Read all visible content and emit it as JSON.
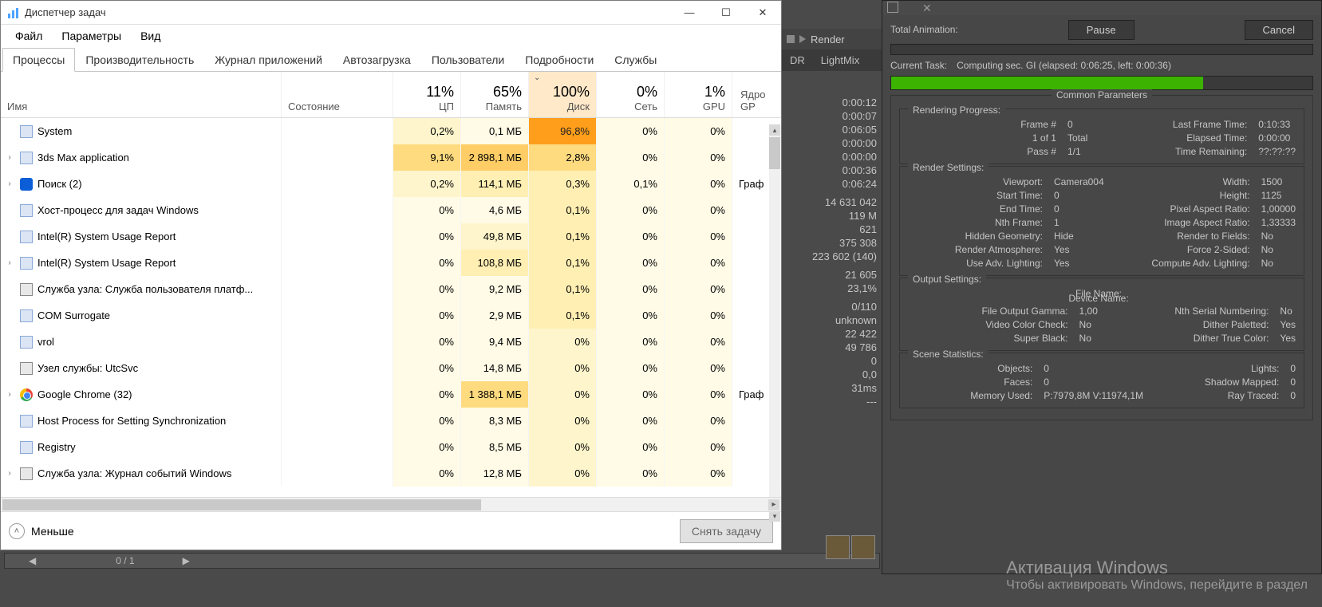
{
  "task_manager": {
    "title": "Диспетчер задач",
    "winbuttons": {
      "min": "—",
      "max": "☐",
      "close": "✕"
    },
    "menu": [
      "Файл",
      "Параметры",
      "Вид"
    ],
    "tabs": [
      "Процессы",
      "Производительность",
      "Журнал приложений",
      "Автозагрузка",
      "Пользователи",
      "Подробности",
      "Службы"
    ],
    "selected_tab": 0,
    "columns": {
      "name": "Имя",
      "state": "Состояние",
      "metrics": [
        {
          "percent": "11%",
          "label": "ЦП"
        },
        {
          "percent": "65%",
          "label": "Память"
        },
        {
          "percent": "100%",
          "label": "Диск",
          "sorted": true
        },
        {
          "percent": "0%",
          "label": "Сеть"
        },
        {
          "percent": "1%",
          "label": "GPU"
        }
      ],
      "engine": "Ядро GP"
    },
    "rows": [
      {
        "expand": false,
        "icon": "app",
        "name": "System",
        "cpu": "0,2%",
        "mem": "0,1 МБ",
        "disk": "96,8%",
        "net": "0%",
        "gpu": "0%",
        "engine": "",
        "heat": [
          2,
          1,
          8,
          1,
          1
        ]
      },
      {
        "expand": true,
        "icon": "app",
        "name": "3ds Max application",
        "cpu": "9,1%",
        "mem": "2 898,1 МБ",
        "disk": "2,8%",
        "net": "0%",
        "gpu": "0%",
        "engine": "",
        "heat": [
          5,
          6,
          5,
          1,
          1
        ]
      },
      {
        "expand": true,
        "icon": "search",
        "name": "Поиск (2)",
        "cpu": "0,2%",
        "mem": "114,1 МБ",
        "disk": "0,3%",
        "net": "0,1%",
        "gpu": "0%",
        "engine": "Граф",
        "heat": [
          2,
          3,
          3,
          1,
          1
        ]
      },
      {
        "expand": false,
        "icon": "app",
        "name": "Хост-процесс для задач Windows",
        "cpu": "0%",
        "mem": "4,6 МБ",
        "disk": "0,1%",
        "net": "0%",
        "gpu": "0%",
        "engine": "",
        "heat": [
          1,
          1,
          3,
          1,
          1
        ]
      },
      {
        "expand": false,
        "icon": "app",
        "name": "Intel(R) System Usage Report",
        "cpu": "0%",
        "mem": "49,8 МБ",
        "disk": "0,1%",
        "net": "0%",
        "gpu": "0%",
        "engine": "",
        "heat": [
          1,
          2,
          3,
          1,
          1
        ]
      },
      {
        "expand": true,
        "icon": "app",
        "name": "Intel(R) System Usage Report",
        "cpu": "0%",
        "mem": "108,8 МБ",
        "disk": "0,1%",
        "net": "0%",
        "gpu": "0%",
        "engine": "",
        "heat": [
          1,
          3,
          3,
          1,
          1
        ]
      },
      {
        "expand": false,
        "icon": "gear",
        "name": "Служба узла: Служба пользователя платф...",
        "cpu": "0%",
        "mem": "9,2 МБ",
        "disk": "0,1%",
        "net": "0%",
        "gpu": "0%",
        "engine": "",
        "heat": [
          1,
          1,
          3,
          1,
          1
        ]
      },
      {
        "expand": false,
        "icon": "app",
        "name": "COM Surrogate",
        "cpu": "0%",
        "mem": "2,9 МБ",
        "disk": "0,1%",
        "net": "0%",
        "gpu": "0%",
        "engine": "",
        "heat": [
          1,
          1,
          3,
          1,
          1
        ]
      },
      {
        "expand": false,
        "icon": "vrol",
        "name": "vrol",
        "cpu": "0%",
        "mem": "9,4 МБ",
        "disk": "0%",
        "net": "0%",
        "gpu": "0%",
        "engine": "",
        "heat": [
          1,
          1,
          2,
          1,
          1
        ]
      },
      {
        "expand": false,
        "icon": "gear",
        "name": "Узел службы: UtcSvc",
        "cpu": "0%",
        "mem": "14,8 МБ",
        "disk": "0%",
        "net": "0%",
        "gpu": "0%",
        "engine": "",
        "heat": [
          1,
          1,
          2,
          1,
          1
        ]
      },
      {
        "expand": true,
        "icon": "chrome",
        "name": "Google Chrome (32)",
        "cpu": "0%",
        "mem": "1 388,1 МБ",
        "disk": "0%",
        "net": "0%",
        "gpu": "0%",
        "engine": "Граф",
        "heat": [
          1,
          5,
          2,
          1,
          1
        ]
      },
      {
        "expand": false,
        "icon": "app",
        "name": "Host Process for Setting Synchronization",
        "cpu": "0%",
        "mem": "8,3 МБ",
        "disk": "0%",
        "net": "0%",
        "gpu": "0%",
        "engine": "",
        "heat": [
          1,
          1,
          2,
          1,
          1
        ]
      },
      {
        "expand": false,
        "icon": "app",
        "name": "Registry",
        "cpu": "0%",
        "mem": "8,5 МБ",
        "disk": "0%",
        "net": "0%",
        "gpu": "0%",
        "engine": "",
        "heat": [
          1,
          1,
          2,
          1,
          1
        ]
      },
      {
        "expand": true,
        "icon": "gear",
        "name": "Служба узла: Журнал событий Windows",
        "cpu": "0%",
        "mem": "12,8 МБ",
        "disk": "0%",
        "net": "0%",
        "gpu": "0%",
        "engine": "",
        "heat": [
          1,
          1,
          2,
          1,
          1
        ]
      }
    ],
    "footer": {
      "fewer": "Меньше",
      "end_task": "Снять задачу"
    }
  },
  "bg_ui": {
    "tabs": [
      "DR",
      "LightMix"
    ],
    "render_btn": "Render",
    "stats_blocks": [
      [
        "0:00:12",
        "0:00:07",
        "0:06:05",
        "0:00:00",
        "0:00:00",
        "0:00:36",
        "0:06:24"
      ],
      [
        "14 631 042",
        "119 M",
        "621",
        "375 308",
        "223 602 (140)"
      ],
      [
        "21 605",
        "23,1%"
      ],
      [
        "0/110",
        "unknown",
        "22 422",
        "49 786",
        "0",
        "0,0",
        "31ms",
        "---"
      ]
    ],
    "timeline_frame": "0 / 1"
  },
  "render_dialog": {
    "total_anim_label": "Total Animation:",
    "pause": "Pause",
    "cancel": "Cancel",
    "current_task_label": "Current Task:",
    "current_task_value": "Computing sec. GI (elapsed: 0:06:25, left: 0:00:36)",
    "common_params": "Common Parameters",
    "rendering_progress": "Rendering Progress:",
    "frame_num_label": "Frame #",
    "frame_num": "0",
    "last_frame_time_label": "Last Frame Time:",
    "last_frame_time": "0:10:33",
    "of_label": "1  of  1",
    "total_label": "Total",
    "elapsed_label": "Elapsed Time:",
    "elapsed": "0:00:00",
    "pass_label": "Pass #",
    "pass": "1/1",
    "time_rem_label": "Time Remaining:",
    "time_rem": "??:??:??",
    "render_settings": "Render Settings:",
    "rs": {
      "viewport_k": "Viewport:",
      "viewport_v": "Camera004",
      "width_k": "Width:",
      "width_v": "1500",
      "start_k": "Start Time:",
      "start_v": "0",
      "height_k": "Height:",
      "height_v": "1125",
      "end_k": "End Time:",
      "end_v": "0",
      "par_k": "Pixel Aspect Ratio:",
      "par_v": "1,00000",
      "nth_k": "Nth Frame:",
      "nth_v": "1",
      "iar_k": "Image Aspect Ratio:",
      "iar_v": "1,33333",
      "hg_k": "Hidden Geometry:",
      "hg_v": "Hide",
      "rtf_k": "Render to Fields:",
      "rtf_v": "No",
      "ra_k": "Render Atmosphere:",
      "ra_v": "Yes",
      "f2s_k": "Force 2-Sided:",
      "f2s_v": "No",
      "ual_k": "Use Adv. Lighting:",
      "ual_v": "Yes",
      "cal_k": "Compute Adv. Lighting:",
      "cal_v": "No"
    },
    "output_settings": "Output Settings:",
    "os": {
      "file_k": "File Name:",
      "file_v": "",
      "dev_k": "Device Name:",
      "dev_v": "",
      "fog_k": "File Output Gamma:",
      "fog_v": "1,00",
      "nsn_k": "Nth Serial Numbering:",
      "nsn_v": "No",
      "vcc_k": "Video Color Check:",
      "vcc_v": "No",
      "dp_k": "Dither Paletted:",
      "dp_v": "Yes",
      "sb_k": "Super Black:",
      "sb_v": "No",
      "dtc_k": "Dither True Color:",
      "dtc_v": "Yes"
    },
    "scene_stats": "Scene Statistics:",
    "ss": {
      "obj_k": "Objects:",
      "obj_v": "0",
      "lights_k": "Lights:",
      "lights_v": "0",
      "faces_k": "Faces:",
      "faces_v": "0",
      "sm_k": "Shadow Mapped:",
      "sm_v": "0",
      "mem_k": "Memory Used:",
      "mem_v": "P:7979,8M V:11974,1M",
      "rt_k": "Ray Traced:",
      "rt_v": "0"
    }
  },
  "watermark": {
    "title": "Активация Windows",
    "subtitle": "Чтобы активировать Windows, перейдите в раздел"
  }
}
